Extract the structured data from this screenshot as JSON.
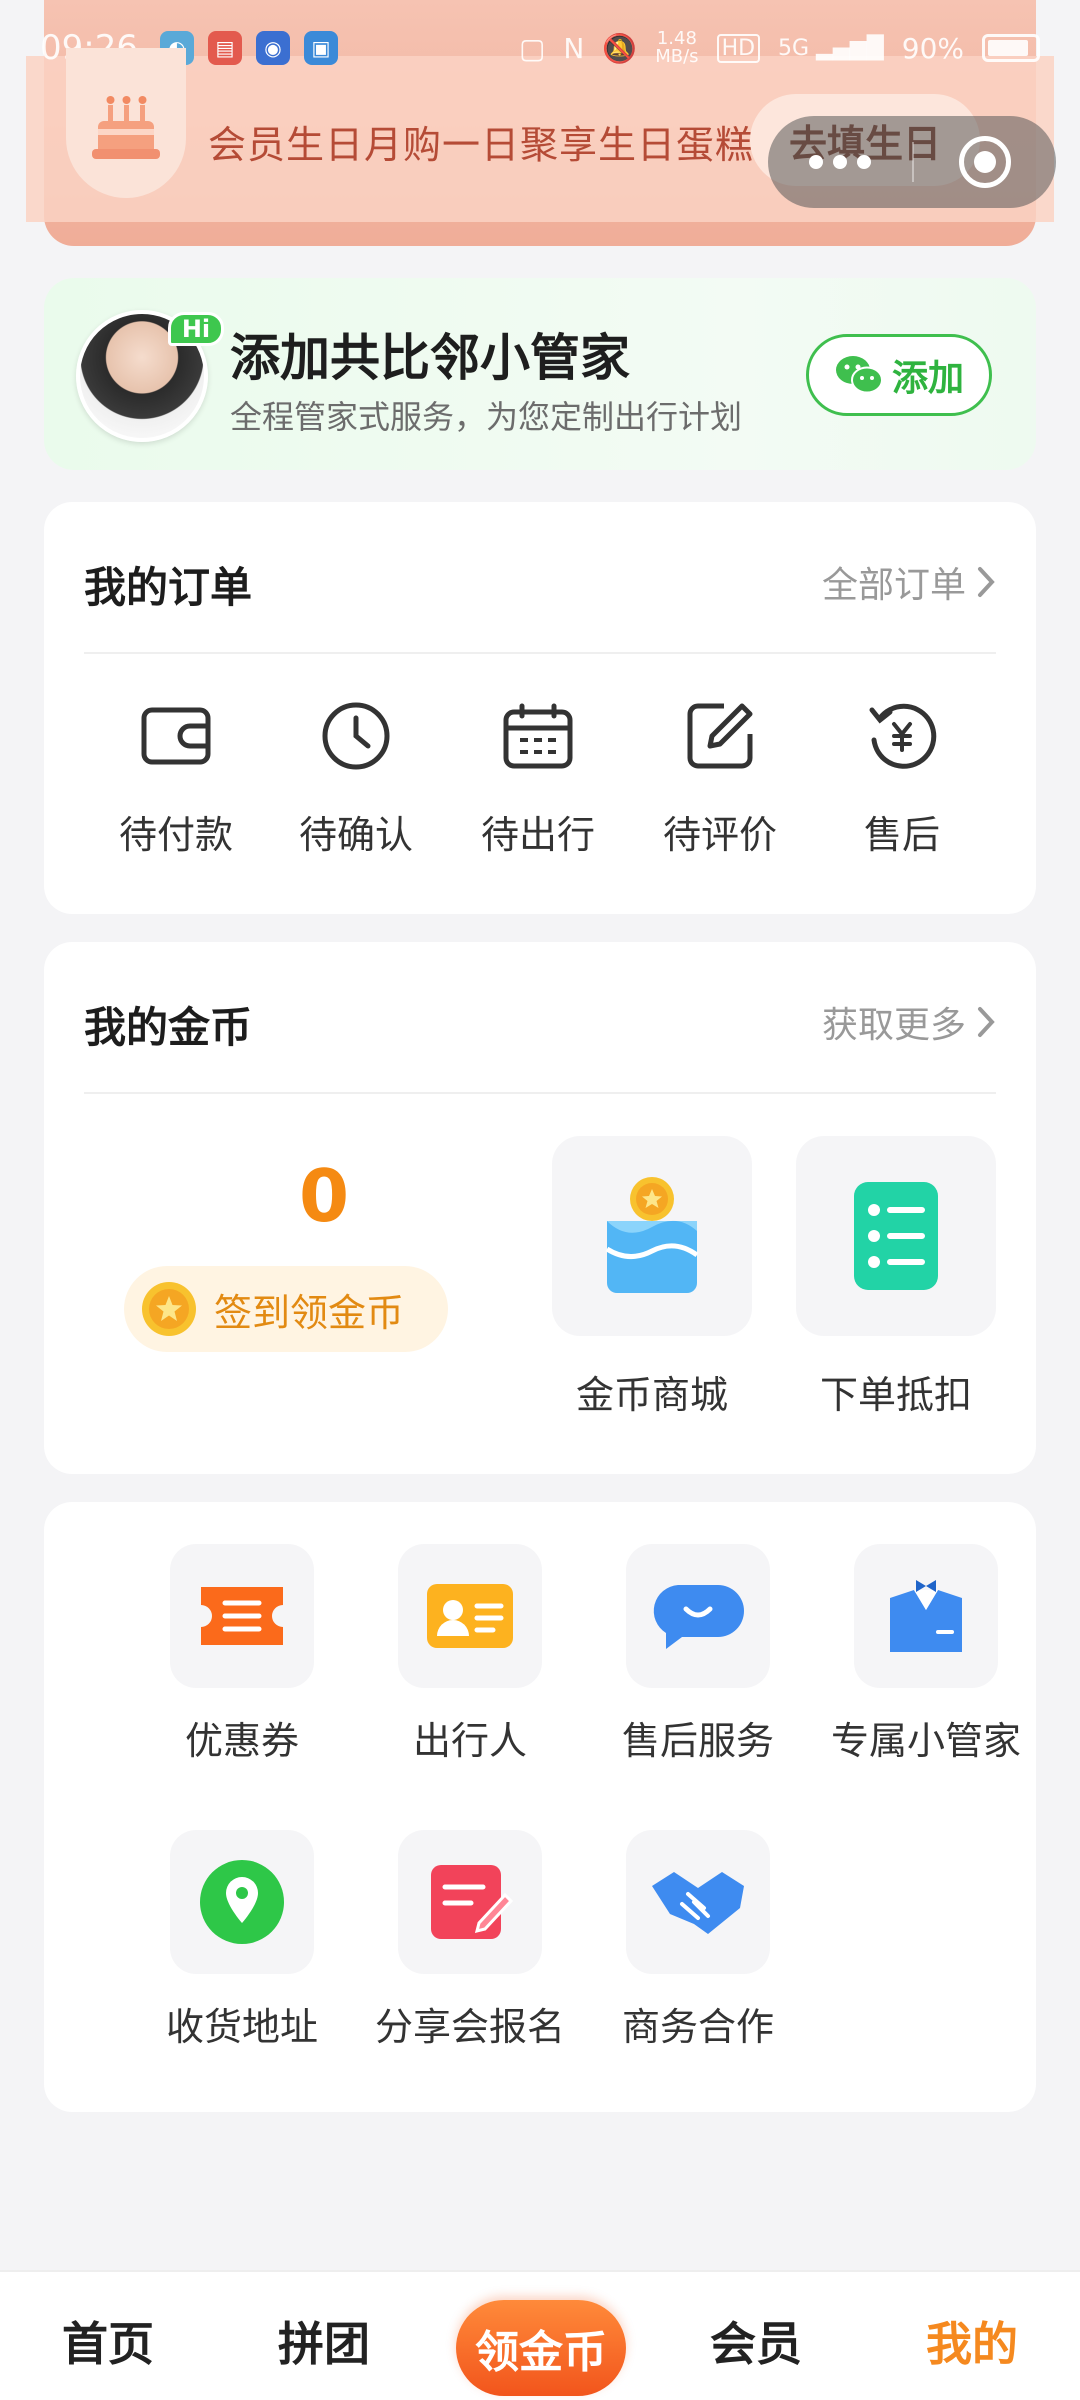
{
  "status_bar": {
    "time": "09:26",
    "speed": "1.48",
    "speed_unit": "MB/s",
    "hd": "HD",
    "net": "5G",
    "battery": "90%"
  },
  "banner": {
    "text": "会员生日月购一日聚享生日蛋糕",
    "button": "去填生日"
  },
  "assistant": {
    "badge": "Hi",
    "title": "添加共比邻小管家",
    "subtitle": "全程管家式服务，为您定制出行计划",
    "add_button": "添加"
  },
  "orders": {
    "title": "我的订单",
    "link": "全部订单",
    "items": [
      {
        "label": "待付款",
        "icon": "wallet-icon"
      },
      {
        "label": "待确认",
        "icon": "clock-icon"
      },
      {
        "label": "待出行",
        "icon": "calendar-icon"
      },
      {
        "label": "待评价",
        "icon": "edit-icon"
      },
      {
        "label": "售后",
        "icon": "refund-icon"
      }
    ]
  },
  "coins": {
    "title": "我的金币",
    "link": "获取更多",
    "count": "0",
    "checkin": "签到领金币",
    "tiles": [
      {
        "label": "金币商城",
        "icon": "coin-shop-icon"
      },
      {
        "label": "下单抵扣",
        "icon": "list-icon"
      }
    ]
  },
  "services": {
    "items": [
      {
        "label": "优惠券",
        "icon": "ticket-icon",
        "color": "#fb6a1b"
      },
      {
        "label": "出行人",
        "icon": "id-card-icon",
        "color": "#fdb21f"
      },
      {
        "label": "售后服务",
        "icon": "chat-icon",
        "color": "#3e8bf0"
      },
      {
        "label": "专属小管家",
        "icon": "butler-icon",
        "color": "#3e8bf0"
      },
      {
        "label": "收货地址",
        "icon": "location-icon",
        "color": "#2ec748"
      },
      {
        "label": "分享会报名",
        "icon": "note-pen-icon",
        "color": "#f2435a"
      },
      {
        "label": "商务合作",
        "icon": "handshake-icon",
        "color": "#3e8bf0"
      }
    ]
  },
  "bottom_nav": {
    "items": [
      "首页",
      "拼团",
      "领金币",
      "会员",
      "我的"
    ],
    "active": "我的"
  },
  "colors": {
    "accent_orange": "#f5891f",
    "coin_orange": "#f58a12",
    "green": "#3fbf4e"
  }
}
